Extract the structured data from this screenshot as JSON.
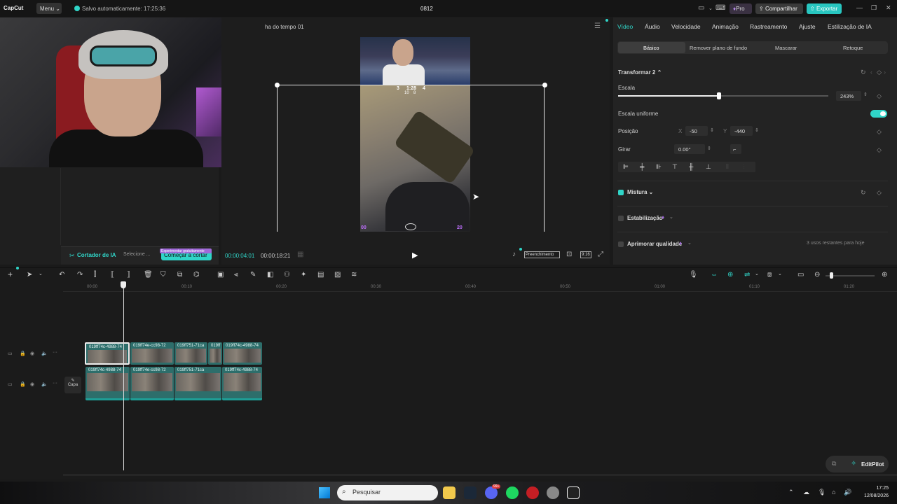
{
  "app": {
    "logo": "CapCut",
    "menu_label": "Menu ⌄",
    "autosave_text": "Salvo automaticamente: 17:25:36",
    "project_name": "0812",
    "pro_label": "Pro",
    "share_label": "Compartilhar",
    "export_label": "Exportar"
  },
  "left_panel": {
    "ai_cutter_label": "Cortador de IA",
    "ai_select_label": "Selecione ...",
    "trial_badge": "Experimentar gratuitamente",
    "start_cut_label": "Começar a cortar"
  },
  "player": {
    "title": "ha do tempo 01",
    "current_time": "00:00:04:01",
    "total_time": "00:00:18:21",
    "fill_label": "Preenchimento",
    "ratio_label": "9:16",
    "hud_score_left": "3",
    "hud_time": "1:28",
    "hud_score_right": "4",
    "hud_sub_left": "10",
    "hud_sub_right": "8",
    "hud_bottom_left": "00",
    "hud_bottom_right": "20"
  },
  "right_panel": {
    "tabs": [
      "Vídeo",
      "Áudio",
      "Velocidade",
      "Animação",
      "Rastreamento",
      "Ajuste",
      "Estilização de IA"
    ],
    "subtabs": [
      "Básico",
      "Remover plano de fundo",
      "Mascarar",
      "Retoque"
    ],
    "transform_label": "Transformar 2 ⌃",
    "scale_label": "Escala",
    "scale_value": "243%",
    "scale_fraction": 0.48,
    "uniform_scale_label": "Escala uniforme",
    "position_label": "Posição",
    "pos_x_label": "X",
    "pos_x_value": "-50",
    "pos_y_label": "Y",
    "pos_y_value": "-440",
    "rotate_label": "Girar",
    "rotate_value": "0.00°",
    "rotate_button": "⌐",
    "blend_label": "Mistura ⌄",
    "stabilize_label": "Estabilização",
    "enhance_label": "Aprimorar qualidade",
    "uses_left_text": "3 usos restantes para hoje"
  },
  "timeline": {
    "ruler": [
      "00:00",
      "00:10",
      "00:20",
      "00:30",
      "00:40",
      "00:50",
      "01:00",
      "01:10",
      "01:20"
    ],
    "track1_clips": [
      "019ff74c-4988-74",
      "019ff74e-cc98-72",
      "019ff751-71ca",
      "019ff",
      "019ff74c-4988-74"
    ],
    "track2_clips": [
      "019ff74c-4988-74",
      "019ff74e-cc98-72",
      "019ff751-71ca",
      "019ff74c-4988-74"
    ],
    "cover_label": "Capa",
    "editpilot_label": "EditPilot"
  },
  "taskbar": {
    "search_placeholder": "Pesquisar",
    "time": "17:25",
    "date": "12/08/2026",
    "badge_count": "99+"
  },
  "colors": {
    "accent": "#30d5c8",
    "export": "#28c6c0",
    "purple": "#a06ad8"
  }
}
